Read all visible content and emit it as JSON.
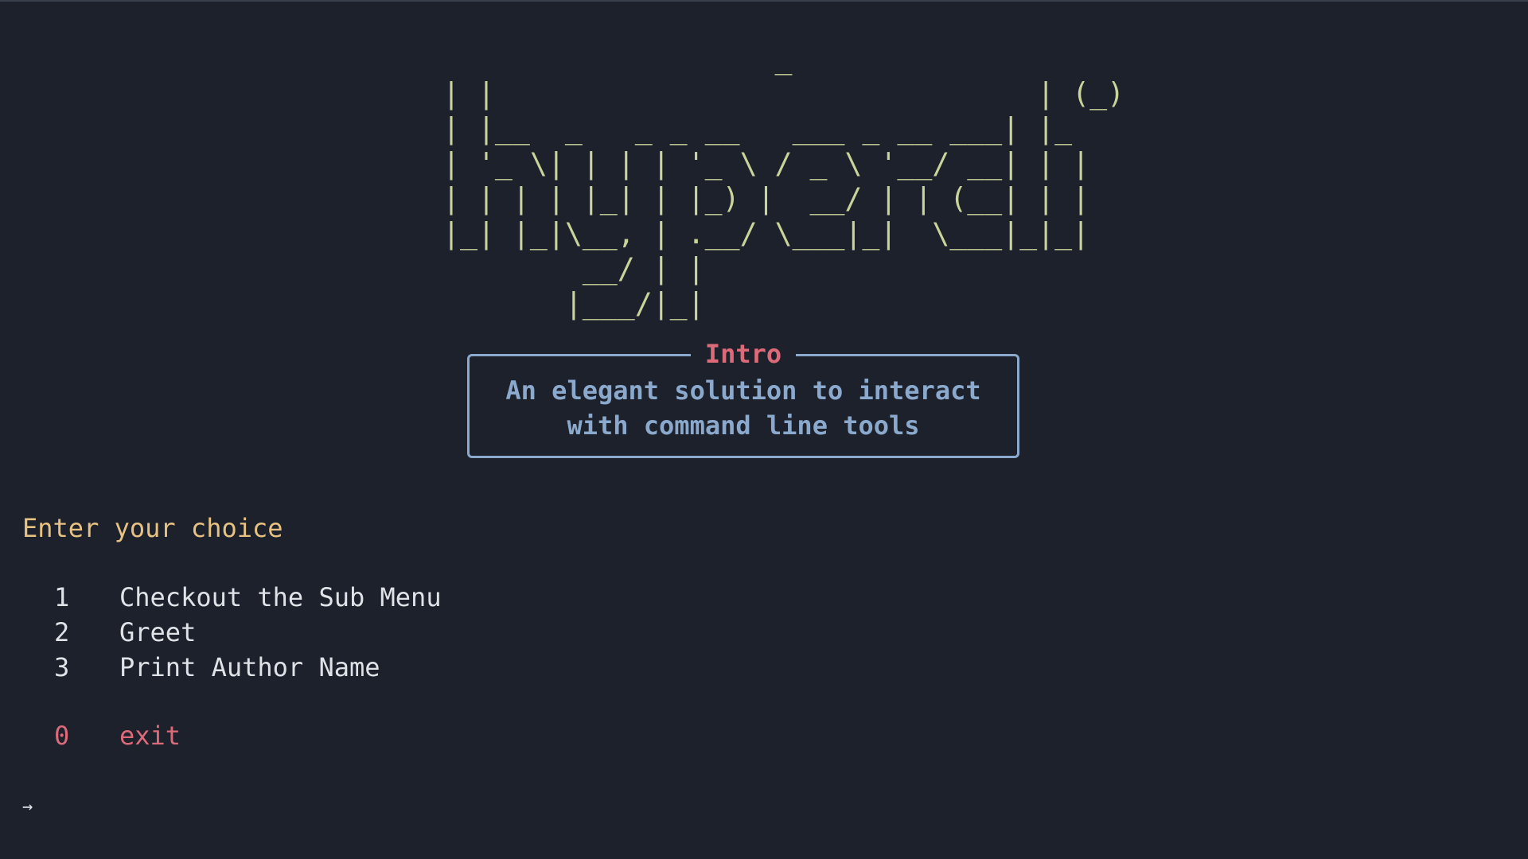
{
  "banner": {
    "art": "                   _              \n| |                               | (_)\n| |__  _   _ _ __   ___ _ __ ___| |_ \n| '_ \\| | | | '_ \\ / _ \\ '__/ __| | |\n| | | | |_| | |_) |  __/ | | (__| | |\n|_| |_|\\__, | .__/ \\___|_|  \\___|_|_|\n        __/ | |                      \n       |___/|_|                      "
  },
  "intro": {
    "title": "Intro",
    "line1": "An elegant solution to interact",
    "line2": "with command line tools"
  },
  "prompt": {
    "heading": "Enter your choice"
  },
  "menu": {
    "items": [
      {
        "key": "1",
        "label": "Checkout the Sub Menu"
      },
      {
        "key": "2",
        "label": "Greet"
      },
      {
        "key": "3",
        "label": "Print Author Name"
      }
    ],
    "exit": {
      "key": "0",
      "label": "exit"
    }
  },
  "cursor": {
    "symbol": "→"
  },
  "colors": {
    "background": "#1c212c",
    "banner": "#c9d49a",
    "box_border": "#8aa9cc",
    "title": "#dd6a79",
    "heading": "#e8c283",
    "text": "#dfe3e8",
    "exit": "#dd6a79"
  }
}
